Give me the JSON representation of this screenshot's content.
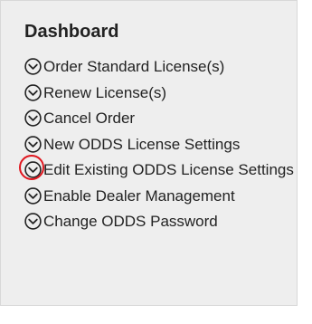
{
  "dashboard": {
    "title": "Dashboard",
    "items": [
      {
        "label": "Order Standard License(s)"
      },
      {
        "label": "Renew License(s)"
      },
      {
        "label": "Cancel Order"
      },
      {
        "label": "New ODDS License Settings"
      },
      {
        "label": "Edit Existing ODDS License Settings",
        "highlighted": true
      },
      {
        "label": "Enable Dealer Management"
      },
      {
        "label": "Change ODDS Password"
      }
    ]
  },
  "icon": "chevron-down-circle-icon",
  "colors": {
    "panel_background": "#eeeeee",
    "text": "#222222",
    "highlight_ring": "#e0161e"
  }
}
